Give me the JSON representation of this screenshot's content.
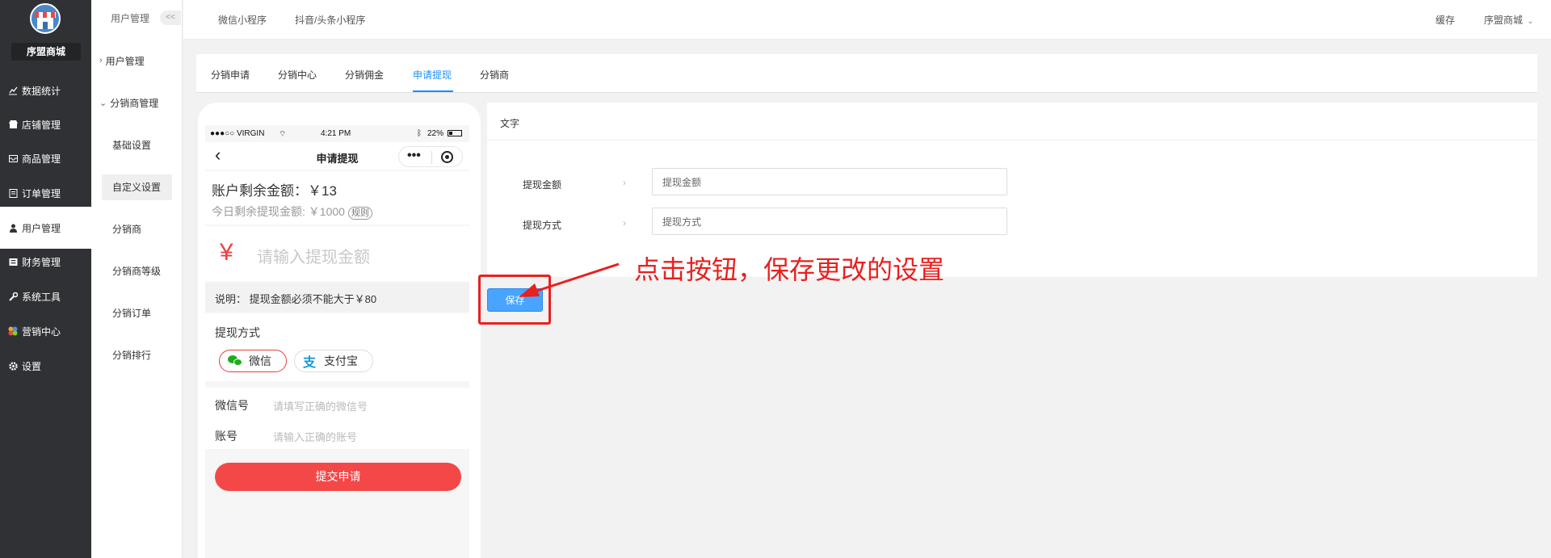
{
  "sidebar": {
    "brand": "序盟商城",
    "items": [
      {
        "label": "数据统计",
        "icon": "chart-line-icon"
      },
      {
        "label": "店铺管理",
        "icon": "shop-icon"
      },
      {
        "label": "商品管理",
        "icon": "inbox-icon"
      },
      {
        "label": "订单管理",
        "icon": "order-icon"
      },
      {
        "label": "用户管理",
        "icon": "user-icon"
      },
      {
        "label": "财务管理",
        "icon": "finance-icon"
      },
      {
        "label": "系统工具",
        "icon": "wrench-icon"
      },
      {
        "label": "营销中心",
        "icon": "marketing-icon"
      },
      {
        "label": "设置",
        "icon": "gear-icon"
      }
    ]
  },
  "subsidebar": {
    "header": "用户管理",
    "collapse": "<<",
    "group_user": "用户管理",
    "group_distributor": "分销商管理",
    "items": [
      "基础设置",
      "自定义设置",
      "分销商",
      "分销商等级",
      "分销订单",
      "分销排行"
    ]
  },
  "topbar": {
    "tabs": [
      "微信小程序",
      "抖音/头条小程序"
    ],
    "cache": "缓存",
    "store": "序盟商城"
  },
  "content_tabs": [
    "分销申请",
    "分销中心",
    "分销佣金",
    "申请提现",
    "分销商"
  ],
  "phone": {
    "status": {
      "carrier": "●●●○○ VIRGIN",
      "time": "4:21 PM",
      "battery": "22%"
    },
    "title": "申请提现",
    "balance": "账户剩余金额：￥13",
    "today_remaining": "今日剩余提现金额: ￥1000",
    "rule": "规则",
    "yen": "¥",
    "amount_placeholder": "请输入提现金额",
    "note": "说明： 提现金额必须不能大于￥80",
    "method_title": "提现方式",
    "wechat": "微信",
    "alipay": "支付宝",
    "wechat_label": "微信号",
    "wechat_placeholder": "请填写正确的微信号",
    "account_label": "账号",
    "account_placeholder": "请输入正确的账号",
    "submit": "提交申请"
  },
  "form": {
    "header": "文字",
    "amount_label": "提现金额",
    "amount_value": "提现金额",
    "method_label": "提现方式",
    "method_value": "提现方式"
  },
  "save_button": "保存",
  "annotation": "点击按钮，保存更改的设置",
  "colors": {
    "accent": "#1890ff",
    "danger": "#f44848",
    "sidebar": "#2f3134"
  }
}
